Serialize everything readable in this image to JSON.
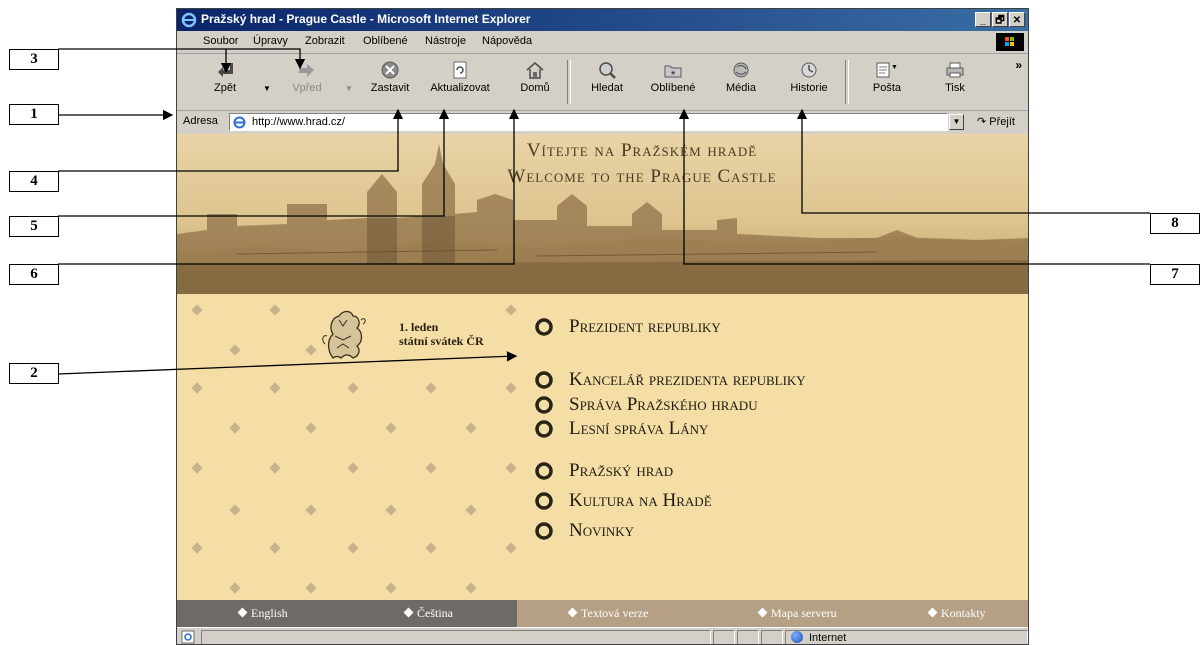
{
  "window": {
    "title": "Pražský hrad - Prague Castle - Microsoft Internet Explorer",
    "controls": [
      "_",
      "🗗",
      "✕"
    ]
  },
  "menubar": [
    "Soubor",
    "Úpravy",
    "Zobrazit",
    "Oblíbené",
    "Nástroje",
    "Nápověda"
  ],
  "toolbar": {
    "back": "Zpět",
    "forward": "Vpřed",
    "stop": "Zastavit",
    "refresh": "Aktualizovat",
    "home": "Domů",
    "search": "Hledat",
    "favorites": "Oblíbené",
    "media": "Média",
    "history": "Historie",
    "mail": "Pošta",
    "print": "Tisk",
    "more": "»"
  },
  "address_bar": {
    "label": "Adresa",
    "url": "http://www.hrad.cz/",
    "go": "Přejít"
  },
  "page": {
    "welcome_cz": "Vítejte na Pražském hradě",
    "welcome_en": "Welcome to the Prague Castle",
    "news_line1": "1. leden",
    "news_line2": "státní svátek ČR",
    "menu": [
      "Prezident republiky",
      "Kancelář prezidenta republiky",
      "Správa Pražského hradu",
      "Lesní správa Lány",
      "Pražský hrad",
      "Kultura na Hradě",
      "Novinky"
    ],
    "bottom_links": [
      "English",
      "Čeština",
      "Textová verze",
      "Mapa serveru",
      "Kontakty"
    ]
  },
  "statusbar": {
    "zone": "Internet"
  },
  "callouts": [
    "1",
    "2",
    "3",
    "4",
    "5",
    "6",
    "7",
    "8"
  ],
  "colors": {
    "titlebar": "#0a246a",
    "page_background": "#f4dea6",
    "bottom_dark": "#6e6a66",
    "bottom_light": "#b6a085"
  }
}
